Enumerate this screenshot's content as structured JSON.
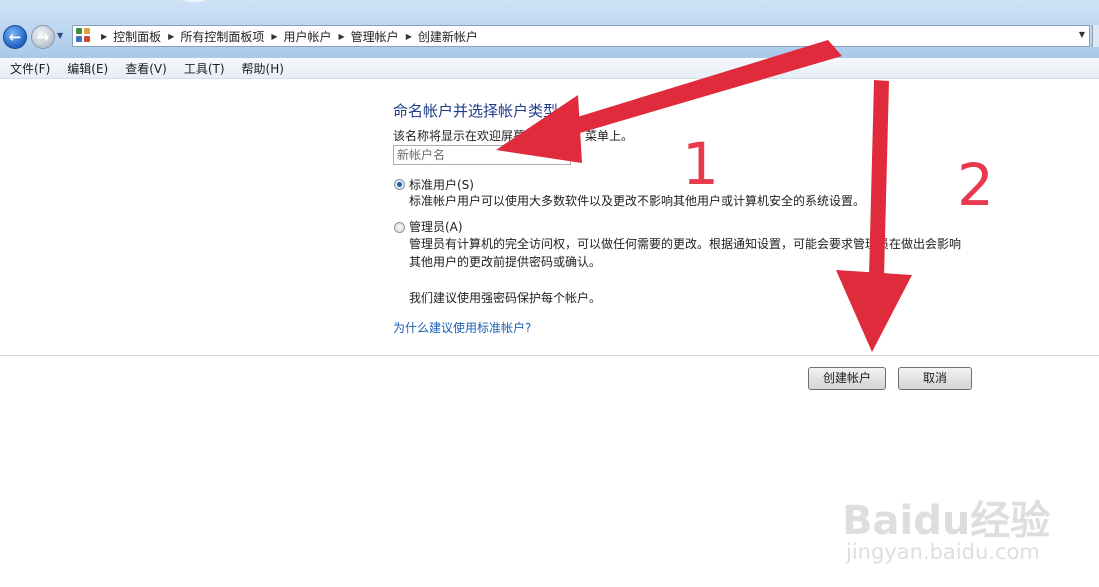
{
  "breadcrumb": [
    "控制面板",
    "所有控制面板项",
    "用户帐户",
    "管理帐户",
    "创建新帐户"
  ],
  "menu": [
    "文件(F)",
    "编辑(E)",
    "查看(V)",
    "工具(T)",
    "帮助(H)"
  ],
  "page": {
    "heading": "命名帐户并选择帐户类型",
    "hint": "该名称将显示在欢迎屏幕和「开始」菜单上。",
    "name_placeholder": "新帐户名",
    "standard_label": "标准用户(S)",
    "standard_desc": "标准帐户用户可以使用大多数软件以及更改不影响其他用户或计算机安全的系统设置。",
    "admin_label": "管理员(A)",
    "admin_desc_1": "管理员有计算机的完全访问权，可以做任何需要的更改。根据通知设置，可能会要求管理员在做出会影响",
    "admin_desc_2": "其他用户的更改前提供密码或确认。",
    "recommend": "我们建议使用强密码保护每个帐户。",
    "link": "为什么建议使用标准帐户?",
    "create_button": "创建帐户",
    "cancel_button": "取消",
    "selected_type": "standard"
  },
  "annotations": {
    "step1": "1",
    "step2": "2",
    "color": "#e8394e"
  },
  "watermark": {
    "main": "Baidu经验",
    "sub": "jingyan.baidu.com"
  },
  "icons": [
    "back-arrow-icon",
    "forward-arrow-icon",
    "control-panel-icon",
    "chevron-right-icon",
    "dropdown-arrow-icon"
  ]
}
